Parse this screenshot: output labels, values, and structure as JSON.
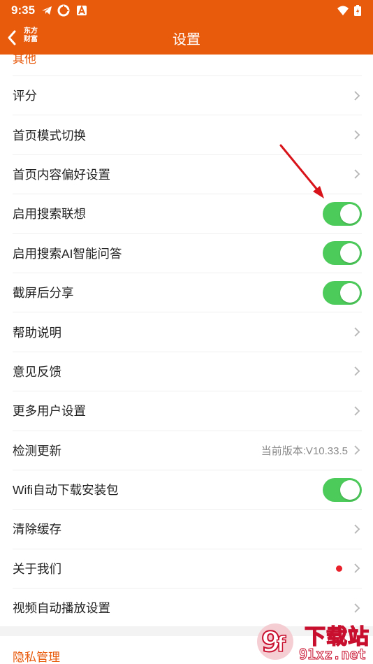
{
  "status_bar": {
    "time": "9:35",
    "icons": [
      "telegram-icon",
      "pinwheel-icon",
      "text-a-icon",
      "wifi-icon",
      "battery-icon"
    ]
  },
  "app_bar": {
    "back_icon": "chevron-left-icon",
    "logo_line1": "东方",
    "logo_line2": "财富",
    "title": "设置",
    "color": "#e85a0c"
  },
  "sections": {
    "other_title": "其他",
    "privacy_title": "隐私管理"
  },
  "rows": [
    {
      "label": "评分",
      "control": "chevron"
    },
    {
      "label": "首页模式切换",
      "control": "chevron"
    },
    {
      "label": "首页内容偏好设置",
      "control": "chevron"
    },
    {
      "label": "启用搜索联想",
      "control": "toggle",
      "on": true
    },
    {
      "label": "启用搜索AI智能问答",
      "control": "toggle",
      "on": true
    },
    {
      "label": "截屏后分享",
      "control": "toggle",
      "on": true
    },
    {
      "label": "帮助说明",
      "control": "chevron"
    },
    {
      "label": "意见反馈",
      "control": "chevron"
    },
    {
      "label": "更多用户设置",
      "control": "chevron"
    },
    {
      "label": "检测更新",
      "control": "chevron",
      "value": "当前版本:V10.33.5"
    },
    {
      "label": "Wifi自动下载安装包",
      "control": "toggle",
      "on": true
    },
    {
      "label": "清除缓存",
      "control": "chevron"
    },
    {
      "label": "关于我们",
      "control": "chevron",
      "badge": "red-dot"
    },
    {
      "label": "视频自动播放设置",
      "control": "chevron"
    }
  ],
  "annotation": {
    "type": "red-arrow",
    "points_to": "启用搜索联想"
  },
  "watermark": {
    "line1": "下载站",
    "line2": "91xz.net",
    "badge": "9f"
  },
  "colors": {
    "accent": "#e85a0c",
    "toggle_on": "#4cca5a",
    "dot": "#e8212b",
    "arrow": "#d8141a"
  }
}
